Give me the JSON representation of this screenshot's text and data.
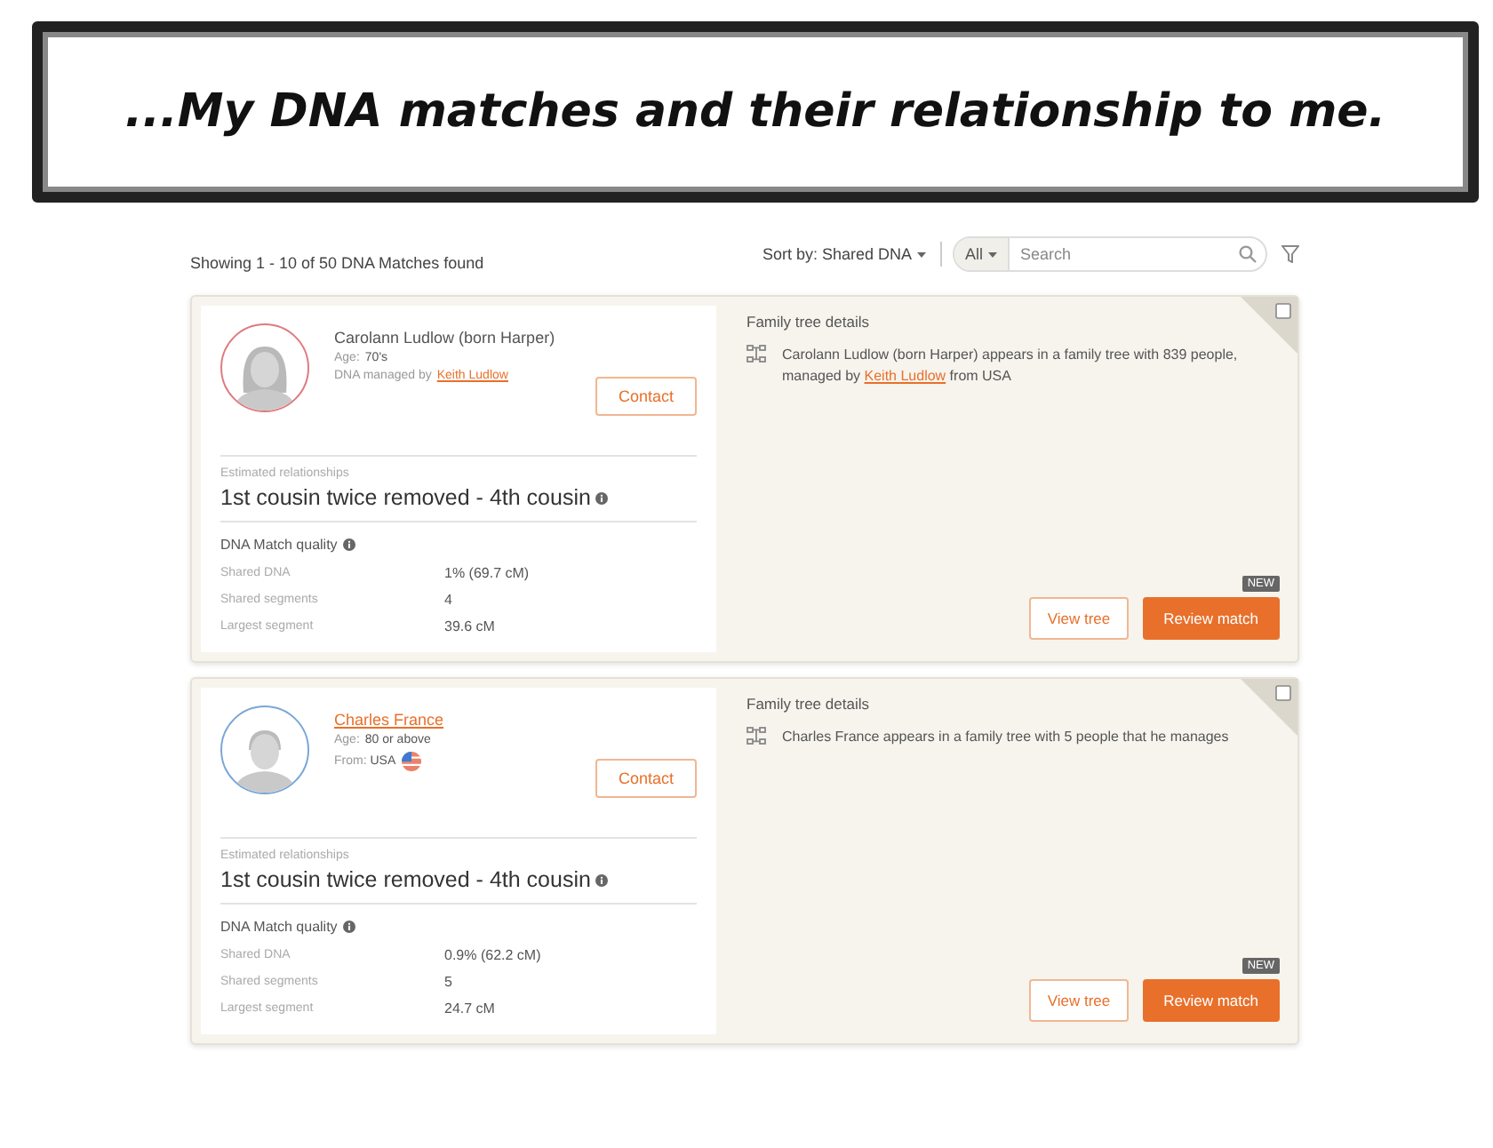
{
  "banner": {
    "title": "...My DNA matches and their relationship to me."
  },
  "toolbar": {
    "summary": "Showing 1 - 10 of 50 DNA Matches found",
    "sort": "Sort by: Shared DNA",
    "filter_scope": "All",
    "search": {
      "placeholder": "Search"
    }
  },
  "matches": [
    {
      "avatar": {
        "color": "#e07a80",
        "kind": "female"
      },
      "name": "Carolann Ludlow (born Harper)",
      "name_link": false,
      "age": {
        "label": "Age:",
        "value": "70's"
      },
      "managed_by": {
        "label": "DNA managed by",
        "link": "Keith Ludlow"
      },
      "contact": "Contact",
      "relationship_label": "Estimated relationships",
      "relationship": "1st cousin twice removed - 4th cousin",
      "quality_title": "DNA Match quality",
      "stats": [
        {
          "label": "Shared DNA",
          "value": "1% (69.7 cM)"
        },
        {
          "label": "Shared segments",
          "value": "4"
        },
        {
          "label": "Largest segment",
          "value": "39.6 cM"
        }
      ],
      "tree_title": "Family tree details",
      "tree_text": [
        {
          "text": "Carolann Ludlow (born Harper) appears in a family tree with 839 people, managed by ",
          "link": false
        },
        {
          "text": "Keith Ludlow",
          "link": true
        },
        {
          "text": " from USA",
          "link": false
        }
      ],
      "badge": "NEW",
      "view_tree": "View tree",
      "review": "Review match"
    },
    {
      "avatar": {
        "color": "#7aa7d6",
        "kind": "male"
      },
      "name": "Charles France",
      "name_link": true,
      "age": {
        "label": "Age:",
        "value": "80 or above"
      },
      "from": {
        "label": "From:",
        "value": "USA"
      },
      "contact": "Contact",
      "relationship_label": "Estimated relationships",
      "relationship": "1st cousin twice removed - 4th cousin",
      "quality_title": "DNA Match quality",
      "stats": [
        {
          "label": "Shared DNA",
          "value": "0.9% (62.2 cM)"
        },
        {
          "label": "Shared segments",
          "value": "5"
        },
        {
          "label": "Largest segment",
          "value": "24.7 cM"
        }
      ],
      "tree_title": "Family tree details",
      "tree_text": [
        {
          "text": "Charles France appears in a family tree with 5 people that he manages",
          "link": false
        }
      ],
      "badge": "NEW",
      "view_tree": "View tree",
      "review": "Review match"
    }
  ]
}
